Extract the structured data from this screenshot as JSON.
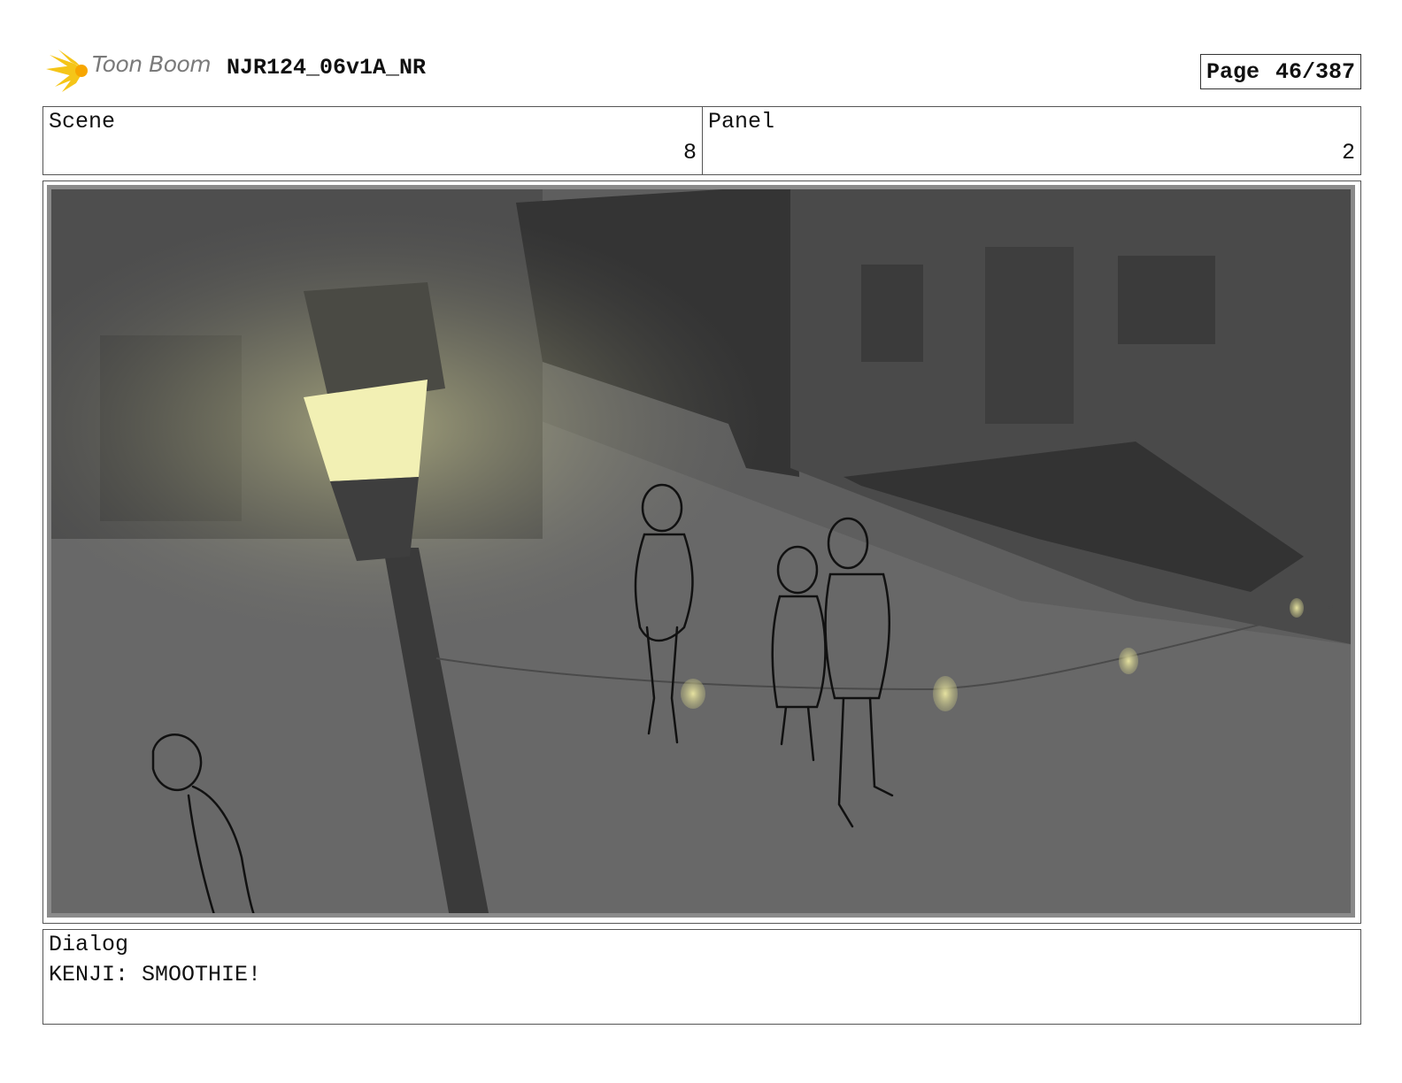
{
  "header": {
    "logo_text": "Toon Boom",
    "project_title": "NJR124_06v1A_NR",
    "page_label": "Page",
    "page_value": "46/387"
  },
  "info": {
    "scene_label": "Scene",
    "scene_value": "8",
    "panel_label": "Panel",
    "panel_value": "2"
  },
  "frame": {
    "description_icon": "storyboard-panel-image"
  },
  "dialog": {
    "label": "Dialog",
    "text": "KENJI: SMOOTHIE!"
  }
}
